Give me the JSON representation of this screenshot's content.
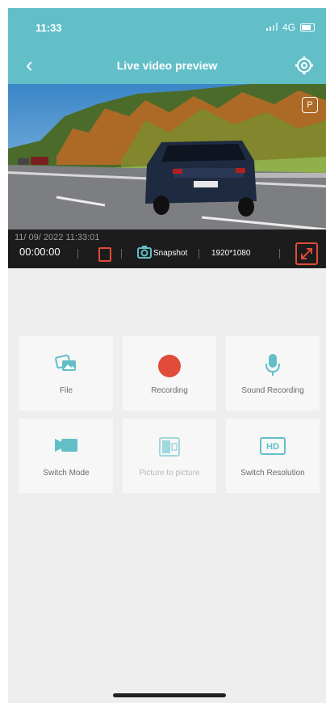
{
  "status": {
    "time": "11:33",
    "network": "4G"
  },
  "header": {
    "title": "Live video preview"
  },
  "video": {
    "date_time": "11/ 09/ 2022  11:33:01",
    "duration": "00:00:00",
    "snapshot_label": "Snapshot",
    "resolution": "1920*1080",
    "badge": "P"
  },
  "functions": {
    "file": "File",
    "recording": "Recording",
    "sound_recording": "Sound Recording",
    "switch_mode": "Switch Mode",
    "picture_in_picture": "Picture to picture",
    "switch_resolution": "Switch Resolution",
    "hd_badge": "HD"
  },
  "colors": {
    "header": "#62bfc8",
    "accent": "#62bfc8",
    "record": "#e04b3a"
  }
}
